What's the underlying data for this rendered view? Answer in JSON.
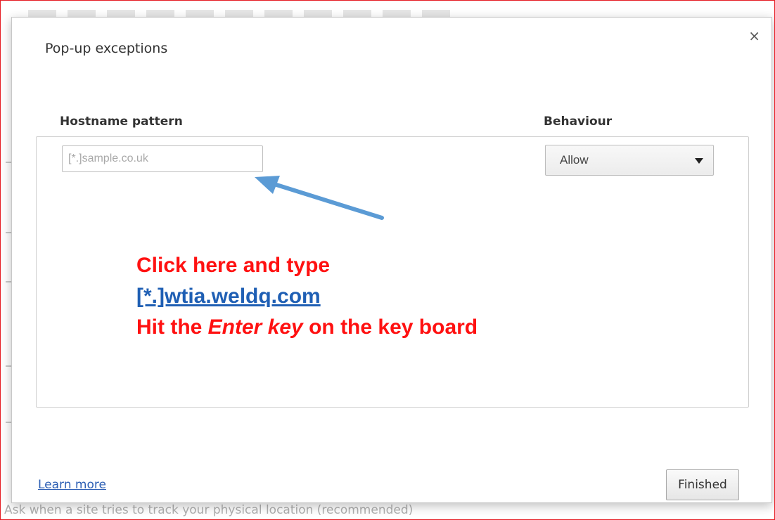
{
  "background": {
    "bottom_text": "Ask when a site tries to track your physical location (recommended)"
  },
  "dialog": {
    "title": "Pop-up exceptions",
    "close_icon": "×",
    "columns": {
      "hostname_header": "Hostname pattern",
      "behaviour_header": "Behaviour"
    },
    "hostname_input": {
      "value": "",
      "placeholder": "[*.]sample.co.uk"
    },
    "behaviour_select": {
      "selected": "Allow"
    },
    "learn_more": "Learn more",
    "finished_button": "Finished"
  },
  "annotation": {
    "line1": "Click here and type",
    "line2": "[*.]wtia.weldq.com",
    "line3_prefix": "Hit the ",
    "line3_em": "Enter key",
    "line3_suffix": " on the key board",
    "arrow_color": "#5b9bd5",
    "text_color": "#ff1111",
    "link_color": "#1f5fb4"
  },
  "colors": {
    "frame_border": "#e51c23",
    "link": "#2d5fb4"
  }
}
